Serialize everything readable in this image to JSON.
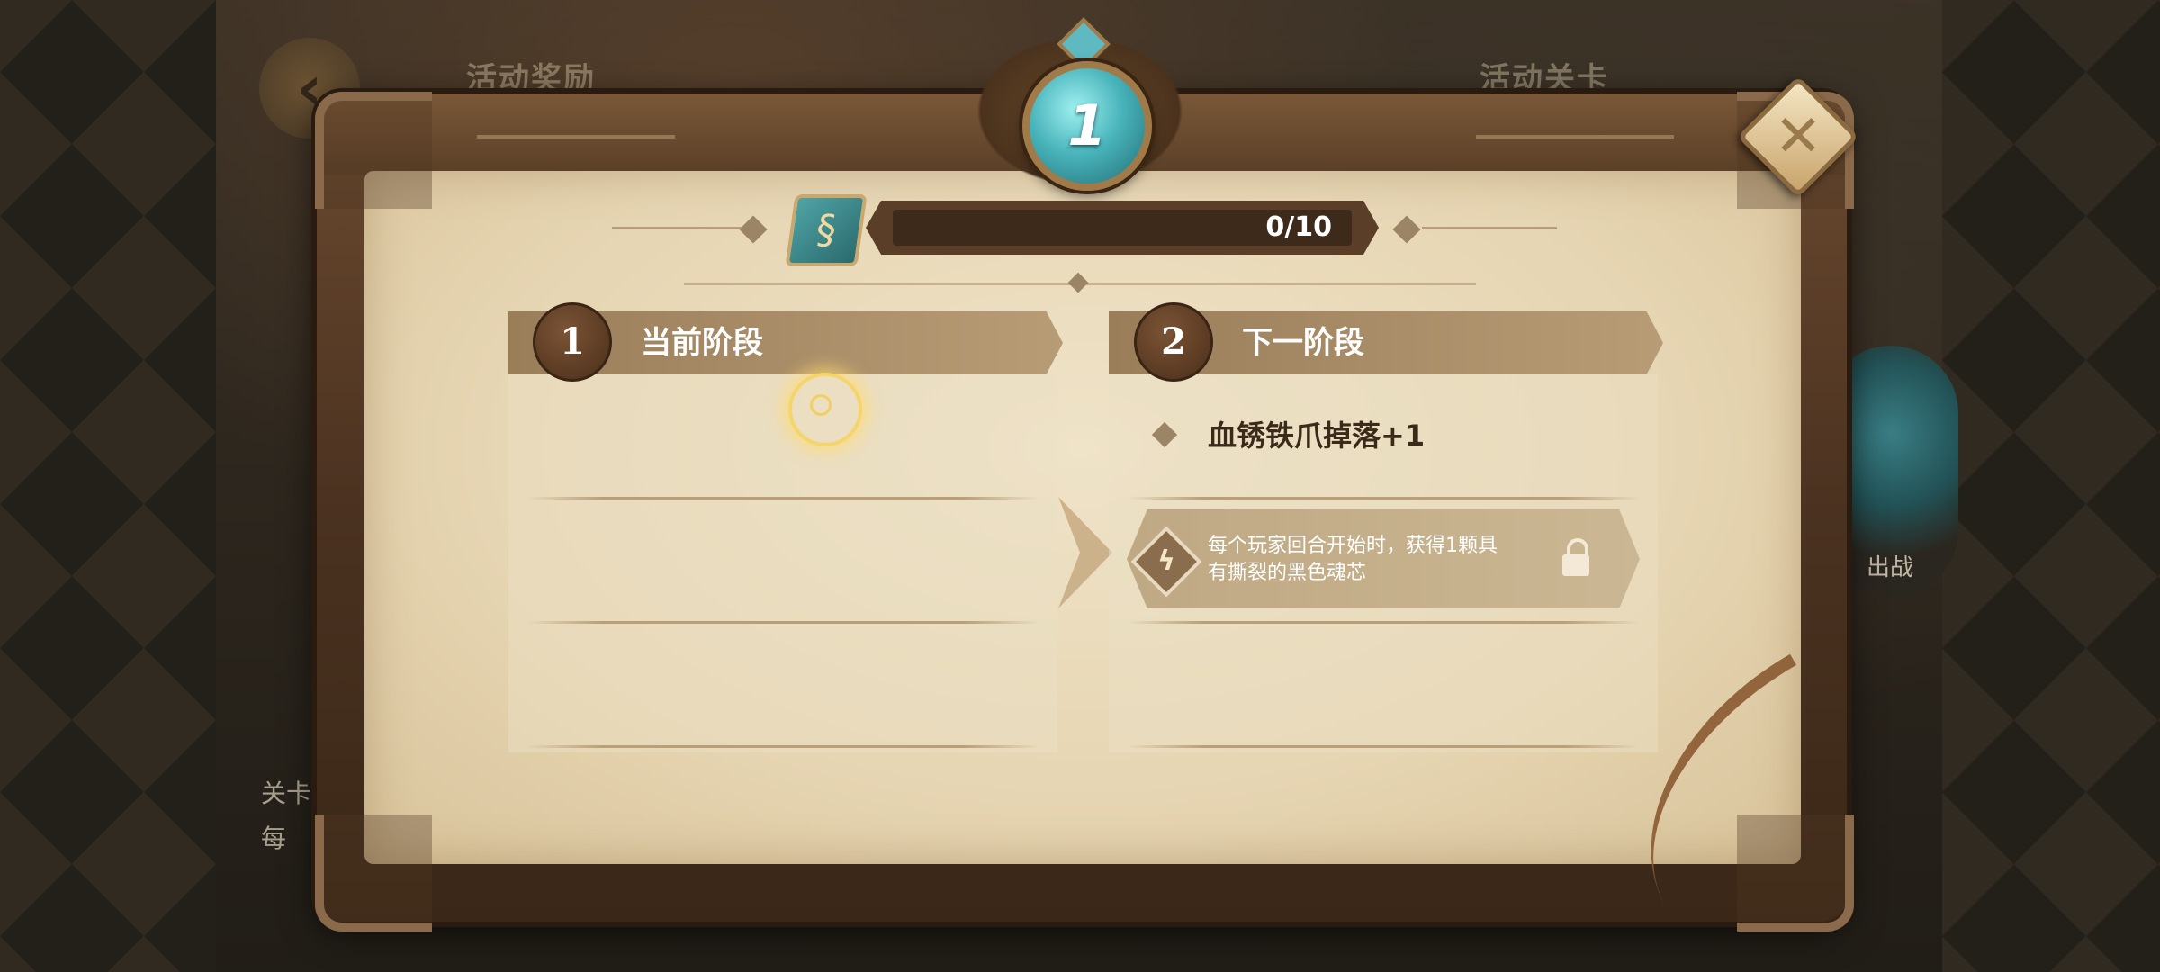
{
  "background": {
    "tab_left": "活动奖励",
    "tab_right": "活动关卡",
    "battle_label": "出战",
    "left_label_1": "关卡",
    "left_label_2": "每"
  },
  "emblem": {
    "level": "1"
  },
  "progress": {
    "text": "0/10",
    "fraction": 0
  },
  "stages": {
    "current": {
      "number": "1",
      "title": "当前阶段"
    },
    "next": {
      "number": "2",
      "title": "下一阶段"
    }
  },
  "next_stage": {
    "reward_text": "血锈铁爪掉落+1",
    "skill_line_1": "每个玩家回合开始时，获得1颗具",
    "skill_line_2": "有撕裂的黑色魂芯"
  },
  "close": {
    "glyph": "✕"
  },
  "colors": {
    "accent_teal": "#49b4bb",
    "parchment": "#e6d5b2",
    "frame_brown": "#4b3220"
  }
}
